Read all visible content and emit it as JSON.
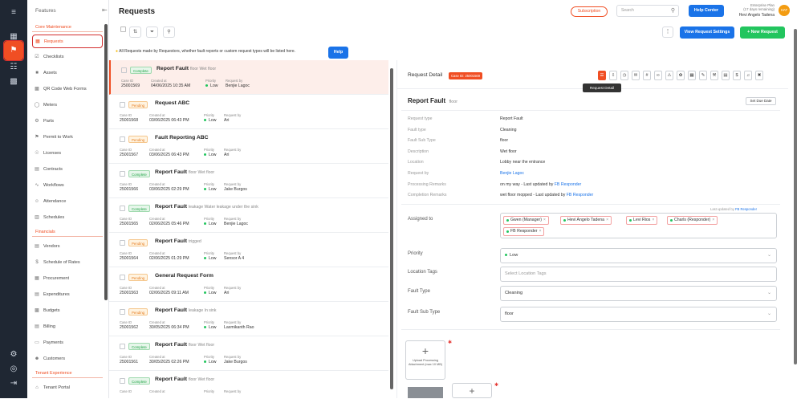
{
  "app": {
    "title": "Requests"
  },
  "sidebar": {
    "header": "Features",
    "sections": {
      "core": "Core Maintenance",
      "financial": "Financials",
      "tenant": "Tenant Experience"
    },
    "items": [
      {
        "label": "Requests",
        "icon": "requests-icon"
      },
      {
        "label": "Checklists",
        "icon": "checklist-icon"
      },
      {
        "label": "Assets",
        "icon": "assets-icon"
      },
      {
        "label": "QR Code Web Forms",
        "icon": "qr-icon"
      },
      {
        "label": "Meters",
        "icon": "meter-icon"
      },
      {
        "label": "Parts",
        "icon": "parts-icon"
      },
      {
        "label": "Permit to Work",
        "icon": "permit-icon"
      },
      {
        "label": "Licenses",
        "icon": "license-icon"
      },
      {
        "label": "Contracts",
        "icon": "contract-icon"
      },
      {
        "label": "Workflows",
        "icon": "workflow-icon"
      },
      {
        "label": "Attendance",
        "icon": "attendance-icon"
      },
      {
        "label": "Schedules",
        "icon": "schedule-icon"
      },
      {
        "label": "Vendors",
        "icon": "vendor-icon"
      },
      {
        "label": "Schedule of Rates",
        "icon": "rates-icon"
      },
      {
        "label": "Procurement",
        "icon": "procurement-icon"
      },
      {
        "label": "Expenditures",
        "icon": "expenditure-icon"
      },
      {
        "label": "Budgets",
        "icon": "budget-icon"
      },
      {
        "label": "Billing",
        "icon": "billing-icon"
      },
      {
        "label": "Payments",
        "icon": "payment-icon"
      },
      {
        "label": "Customers",
        "icon": "customer-icon"
      },
      {
        "label": "Tenant Portal",
        "icon": "tenant-icon"
      }
    ]
  },
  "topbar": {
    "subscription": "Subscription",
    "search_placeholder": "Search",
    "help_center": "Help Center",
    "plan": "Enterprise Plan",
    "plan_note": "(17 days remaining)",
    "user_name": "Hevi Angelo Tadena",
    "avatar_initials": "HAT"
  },
  "toolbar": {
    "view_settings": "View Request Settings",
    "new_request": "+ New Request"
  },
  "info": {
    "text": "All Requests made by Requestors, whether fault reports or custom request types will be listed here.",
    "help": "Help"
  },
  "list_labels": {
    "case_id": "Case ID",
    "created_at": "Created at",
    "priority": "Priority",
    "request_by": "Request by"
  },
  "requests": [
    {
      "status": "Complete",
      "title": "Report Fault",
      "desc": "floor Wet floor",
      "case_id": "25001569",
      "created": "04/06/2025 10:35 AM",
      "priority": "Low",
      "by": "Benjie Lagoc"
    },
    {
      "status": "Pending",
      "title": "Request ABC",
      "desc": "",
      "case_id": "25001568",
      "created": "03/06/2025 06:43 PM",
      "priority": "Low",
      "by": "Ari"
    },
    {
      "status": "Pending",
      "title": "Fault Reporting ABC",
      "desc": "",
      "case_id": "25001567",
      "created": "03/06/2025 06:43 PM",
      "priority": "Low",
      "by": "Ari"
    },
    {
      "status": "Complete",
      "title": "Report Fault",
      "desc": "floor Wet floor",
      "case_id": "25001566",
      "created": "03/06/2025 02:29 PM",
      "priority": "Low",
      "by": "Jake Burgos"
    },
    {
      "status": "Complete",
      "title": "Report Fault",
      "desc": "leakage Water leakage under the sink",
      "case_id": "25001565",
      "created": "02/06/2025 05:46 PM",
      "priority": "Low",
      "by": "Benjie Lagoc"
    },
    {
      "status": "Pending",
      "title": "Report Fault",
      "desc": "trigged",
      "case_id": "25001564",
      "created": "02/06/2025 01:29 PM",
      "priority": "Low",
      "by": "Sensor A 4"
    },
    {
      "status": "Pending",
      "title": "General Request Form",
      "desc": "",
      "case_id": "25001563",
      "created": "02/06/2025 09:11 AM",
      "priority": "Low",
      "by": "Ari"
    },
    {
      "status": "Pending",
      "title": "Report Fault",
      "desc": "leakage In sink",
      "case_id": "25001562",
      "created": "30/05/2025 06:34 PM",
      "priority": "Low",
      "by": "Laxmikanth Rao"
    },
    {
      "status": "Complete",
      "title": "Report Fault",
      "desc": "floor Wet floor",
      "case_id": "25001561",
      "created": "30/05/2025 02:26 PM",
      "priority": "Low",
      "by": "Jake Burgos"
    },
    {
      "status": "Complete",
      "title": "Report Fault",
      "desc": "floor Wet floor",
      "case_id": "",
      "created": "",
      "priority": "",
      "by": ""
    }
  ],
  "detail": {
    "header": "Request Detail",
    "case_badge": "Case ID: 25001569",
    "tooltip": "Request Detail",
    "title": "Report Fault",
    "subtitle": "floor",
    "set_due": "Set Due Date",
    "fields": [
      {
        "k": "Request type",
        "v": "Report Fault"
      },
      {
        "k": "Fault type",
        "v": "Cleaning"
      },
      {
        "k": "Fault Sub Type",
        "v": "floor"
      },
      {
        "k": "Description",
        "v": "Wet floor"
      },
      {
        "k": "Location",
        "v": "Lobby near the entrance"
      },
      {
        "k": "Request by",
        "v": "Benjie Lagoc"
      },
      {
        "k": "Processing Remarks",
        "v": "on my way - Last updated by ",
        "link": "FB Responder"
      },
      {
        "k": "Completion Remarks",
        "v": "wet floor mopped - Last updated by ",
        "link": "FB Responder"
      }
    ],
    "last_updated": "Last updated by ",
    "last_updated_link": "FB Responder",
    "assigned_label": "Assigned to",
    "assignees": [
      "Gwen (Manager)",
      "Hevi Angelo Tadena",
      "Levi Rios",
      "Charls (Responder)",
      "FB Responder"
    ],
    "priority_label": "Priority",
    "priority_value": "Low",
    "location_tags_label": "Location Tags",
    "location_tags_placeholder": "Select Location Tags",
    "fault_type_label": "Fault Type",
    "fault_type_value": "Cleaning",
    "fault_sub_label": "Fault Sub Type",
    "fault_sub_value": "floor",
    "upload_text": "Upload Processing Attachment (max 10 MB)"
  },
  "colors": {
    "accent": "#f04e23",
    "primary": "#1a73e8",
    "success": "#22c55e"
  }
}
